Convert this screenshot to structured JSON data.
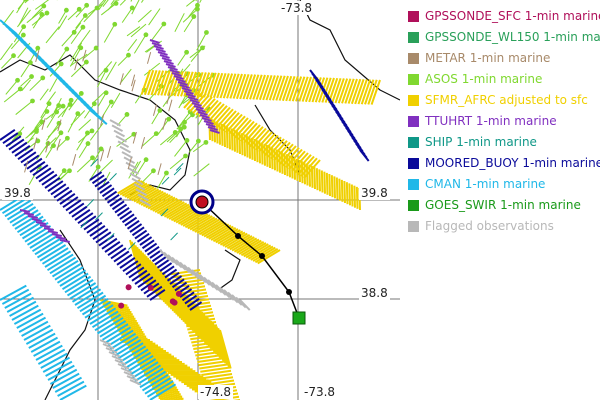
{
  "map": {
    "lat_labels": {
      "upper_left": "39.8",
      "upper_right": "39.8",
      "lower_right": "38.8"
    },
    "lon_labels": {
      "top": "-73.8",
      "bottom_left": "-74.8",
      "bottom_right": "-73.8"
    }
  },
  "legend": {
    "items": [
      {
        "label": "GPSSONDE_SFC 1-min marine",
        "color": "#b0105a"
      },
      {
        "label": "GPSSONDE_WL150 1-min marine",
        "color": "#2aa05a"
      },
      {
        "label": "METAR 1-min marine",
        "color": "#a88a6a"
      },
      {
        "label": "ASOS 1-min marine",
        "color": "#80d830"
      },
      {
        "label": "SFMR_AFRC adjusted to sfc",
        "color": "#f0d000"
      },
      {
        "label": "TTUHRT 1-min marine",
        "color": "#8030c0"
      },
      {
        "label": "SHIP 1-min marine",
        "color": "#109888"
      },
      {
        "label": "MOORED_BUOY 1-min marine",
        "color": "#0a0a9a"
      },
      {
        "label": "CMAN 1-min marine",
        "color": "#20b8e8"
      },
      {
        "label": "GOES_SWIR 1-min marine",
        "color": "#1a9a1a"
      },
      {
        "label": "Flagged observations",
        "color": "#b8b8b8"
      }
    ]
  }
}
